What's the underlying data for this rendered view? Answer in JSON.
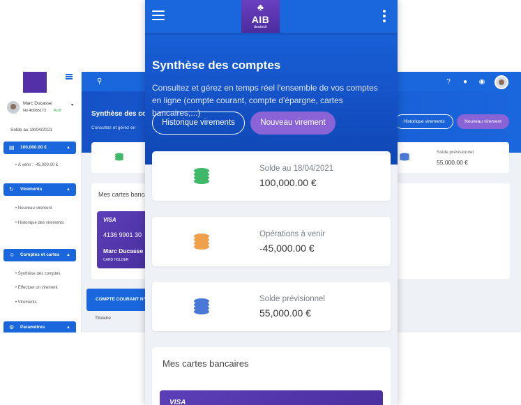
{
  "colors": {
    "primary": "#1a66dd",
    "accent_purple": "#8a63d6",
    "logo_purple": "#5330a8",
    "active_green": "#2fb344"
  },
  "desktop": {
    "sidebar": {
      "user_name": "Marc Ducasse",
      "user_no": "No 40065173",
      "status": "Actif",
      "solde_label": "Solde au 18/04/2021",
      "balance_block": "100,000.00 €",
      "a_venir": "À venir : -45,000.00 €",
      "sections": [
        {
          "label": "Virements",
          "items": [
            "Nouveau virement",
            "Historique des virements"
          ]
        },
        {
          "label": "Comptes et cartes",
          "items": [
            "Synthèse des comptes",
            "Effectuer un virement",
            "Virements"
          ]
        },
        {
          "label": "Paramètres"
        }
      ]
    },
    "title": "Synthèse des co",
    "subtitle": "Consultez et gérez en",
    "btn_history": "Historique virements",
    "btn_new": "Nouveau virement",
    "card_label": "Solde prévisionnel",
    "card_value": "55,000.00 €",
    "cards_title": "Mes cartes banca",
    "visa": {
      "brand": "VISA",
      "number": "4136 9901 30",
      "holder": "Marc Ducasse",
      "holder_label": "CARD HOLDER"
    },
    "account_header": "COMPTE COURANT N°",
    "titulaire": "Titulaire"
  },
  "mobile": {
    "logo": {
      "name": "AIB",
      "sub": "deutsch"
    },
    "title": "Synthèse des comptes",
    "description": "Consultez et gérez en temps réel l'ensemble de vos comptes en ligne (compte courant, compte d'épargne, cartes bancaires,...)",
    "btn_history": "Historique virements",
    "btn_new": "Nouveau virement",
    "cards": [
      {
        "label": "Solde au 18/04/2021",
        "value": "100,000.00 €",
        "coin_color": "#3fb86a",
        "coin_icon": "coins-green-icon"
      },
      {
        "label": "Opérations à venir",
        "value": "-45,000.00 €",
        "coin_color": "#f0a04b",
        "coin_icon": "coins-orange-icon"
      },
      {
        "label": "Solde prévisionnel",
        "value": "55,000.00 €",
        "coin_color": "#4a78d6",
        "coin_icon": "coins-blue-icon"
      }
    ],
    "bank_cards_title": "Mes cartes bancaires",
    "visa_brand": "VISA"
  }
}
